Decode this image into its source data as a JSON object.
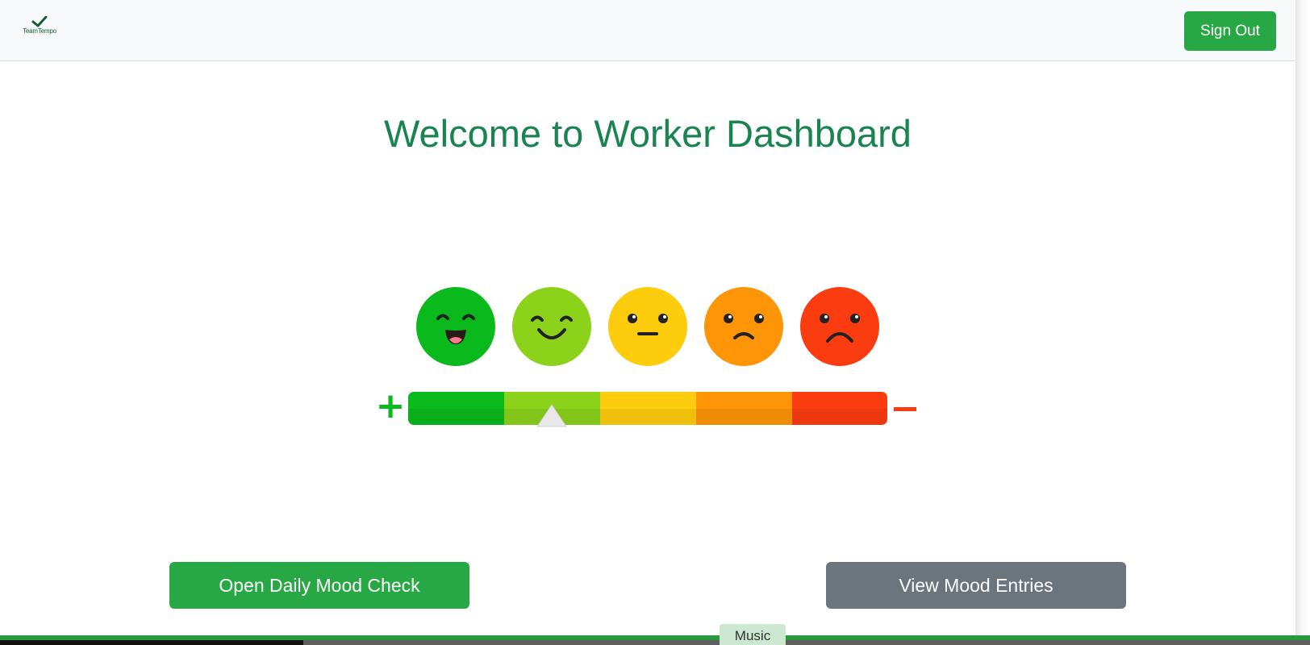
{
  "navbar": {
    "brand": {
      "text": "TeamTempo",
      "icon": "checkmark-icon"
    },
    "sign_out_label": "Sign Out"
  },
  "main": {
    "title": "Welcome to Worker Dashboard",
    "mood_scale": {
      "faces": [
        {
          "icon": "very-happy-face-icon",
          "color": "#0ab91c"
        },
        {
          "icon": "happy-face-icon",
          "color": "#8cd11a"
        },
        {
          "icon": "neutral-face-icon",
          "color": "#fdcc0d"
        },
        {
          "icon": "sad-face-icon",
          "color": "#fd9507"
        },
        {
          "icon": "very-sad-face-icon",
          "color": "#fb3b10"
        }
      ],
      "plus_symbol": "+",
      "minus_symbol": "−",
      "selected_index": 1
    },
    "open_mood_check_label": "Open Daily Mood Check",
    "view_mood_entries_label": "View Mood Entries"
  },
  "footer": {
    "music_tab_label": "Music"
  },
  "colors": {
    "primary_green": "#28a745",
    "secondary_grey": "#6c757d",
    "title_green": "#1a8450"
  }
}
